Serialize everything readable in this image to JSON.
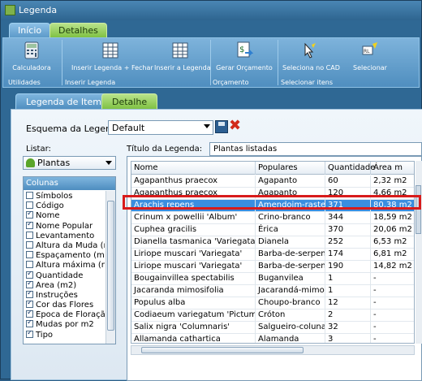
{
  "window": {
    "title": "Legenda"
  },
  "ribbon_tabs": [
    "Início",
    "Detalhes"
  ],
  "ribbon": {
    "buttons": [
      {
        "label": "Calculadora",
        "icon": "calculator-icon"
      },
      {
        "label": "Inserir Legenda + Fechar",
        "icon": "table-icon"
      },
      {
        "label": "Inserir a Legenda",
        "icon": "table-icon"
      },
      {
        "label": "Gerar Orçamento",
        "icon": "budget-icon"
      },
      {
        "label": "Seleciona no CAD",
        "icon": "cursor-icon"
      },
      {
        "label": "Selecionar",
        "icon": "select-icon"
      }
    ],
    "groups": [
      "Utilidades",
      "Inserir Legenda",
      "Orçamento",
      "Selecionar itens"
    ]
  },
  "sub_tabs": [
    "Legenda de Item",
    "Detalhe"
  ],
  "esquema": {
    "label": "Esquema da Legenda:",
    "value": "Default"
  },
  "listar": {
    "label": "Listar:",
    "value": "Plantas"
  },
  "colunas": {
    "title": "Colunas",
    "items": [
      {
        "label": "Símbolos",
        "checked": false
      },
      {
        "label": "Código",
        "checked": false
      },
      {
        "label": "Nome",
        "checked": true
      },
      {
        "label": "Nome Popular",
        "checked": true
      },
      {
        "label": "Levantamento",
        "checked": false
      },
      {
        "label": "Altura da Muda (m",
        "checked": false
      },
      {
        "label": "Espaçamento (m)",
        "checked": false
      },
      {
        "label": "Altura máxima (m)",
        "checked": false
      },
      {
        "label": "Quantidade",
        "checked": true
      },
      {
        "label": "Área (m2)",
        "checked": true
      },
      {
        "label": "Instruções",
        "checked": true
      },
      {
        "label": "Cor das Flores",
        "checked": true
      },
      {
        "label": "Época de Floração",
        "checked": true
      },
      {
        "label": "Mudas por m2",
        "checked": true
      },
      {
        "label": "Tipo",
        "checked": true
      }
    ]
  },
  "titulo": {
    "label": "Título da Legenda:",
    "value": "Plantas listadas"
  },
  "grid": {
    "headers": [
      "Nome",
      "Populares",
      "Quantidade",
      "Área m"
    ],
    "rows": [
      [
        "Agapanthus praecox",
        "Agapanto",
        "60",
        "2,32 m2"
      ],
      [
        "Agapanthus praecox",
        "Agapanto",
        "120",
        "4,66 m2"
      ],
      [
        "Arachis repens",
        "Amendoim-rasteiro",
        "371",
        "80,38 m2"
      ],
      [
        "Crinum x powellii 'Album'",
        "Crino-branco",
        "344",
        "18,59 m2"
      ],
      [
        "Cuphea gracilis",
        "Érica",
        "370",
        "20,06 m2"
      ],
      [
        "Dianella tasmanica 'Variegata'",
        "Dianela",
        "252",
        "6,53 m2"
      ],
      [
        "Liriope muscari 'Variegata'",
        "Barba-de-serpente",
        "174",
        "6,81 m2"
      ],
      [
        "Liriope muscari 'Variegata'",
        "Barba-de-serpente",
        "190",
        "14,82 m2"
      ],
      [
        "Bougainvillea spectabilis",
        "Buganvilea",
        "1",
        "-"
      ],
      [
        "Jacaranda mimosifolia",
        "Jacarandá-mimoso",
        "1",
        "-"
      ],
      [
        "Populus alba",
        "Choupo-branco",
        "12",
        "-"
      ],
      [
        "Codiaeum variegatum 'Pictum Spot'",
        "Cróton",
        "2",
        "-"
      ],
      [
        "Salix nigra 'Columnaris'",
        "Salgueiro-colunar",
        "32",
        "-"
      ],
      [
        "Allamanda cathartica",
        "Alamanda",
        "3",
        "-"
      ]
    ],
    "selected_row": 2
  }
}
